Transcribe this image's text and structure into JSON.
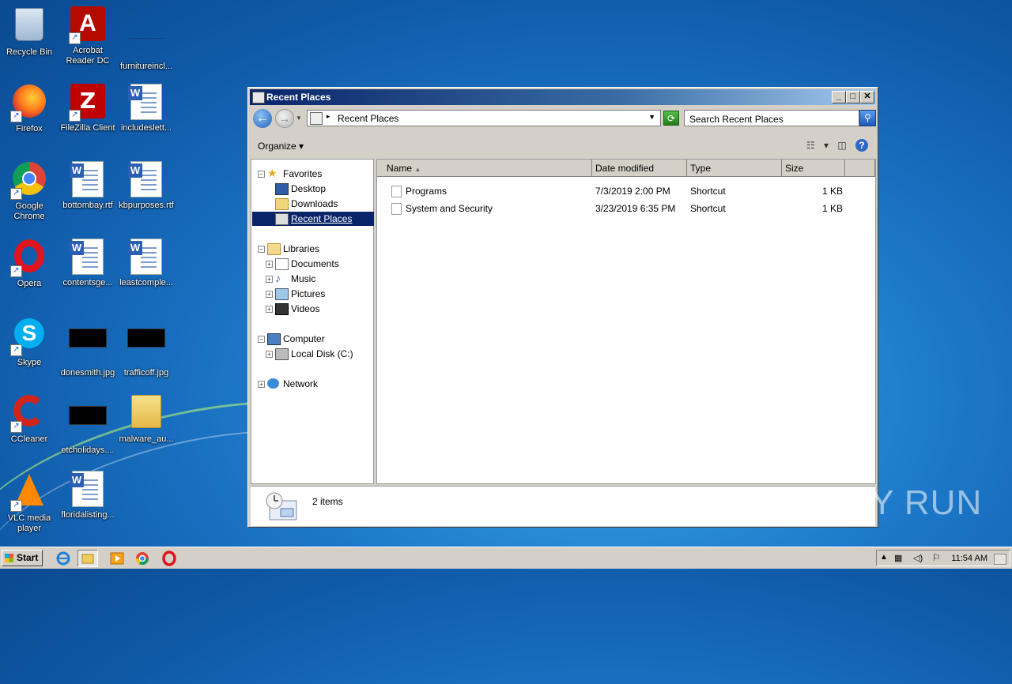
{
  "desktop": {
    "icons": [
      {
        "label": "Recycle Bin"
      },
      {
        "label": "Acrobat Reader DC"
      },
      {
        "label": "furnitureincl..."
      },
      {
        "label": "Firefox"
      },
      {
        "label": "FileZilla Client"
      },
      {
        "label": "includeslett..."
      },
      {
        "label": "Google Chrome"
      },
      {
        "label": "bottombay.rtf"
      },
      {
        "label": "kbpurposes.rtf"
      },
      {
        "label": "Opera"
      },
      {
        "label": "contentsge..."
      },
      {
        "label": "leastcomple..."
      },
      {
        "label": "Skype"
      },
      {
        "label": "donesmith.jpg"
      },
      {
        "label": "trafficoff.jpg"
      },
      {
        "label": "CCleaner"
      },
      {
        "label": "etcholidays...."
      },
      {
        "label": "malware_au..."
      },
      {
        "label": "VLC media player"
      },
      {
        "label": "floridalisting..."
      }
    ]
  },
  "window": {
    "title": "Recent Places",
    "address": "Recent Places",
    "search_placeholder": "Search Recent Places",
    "organize_label": "Organize",
    "nav": {
      "favorites": "Favorites",
      "desktop": "Desktop",
      "downloads": "Downloads",
      "recent_places": "Recent Places",
      "libraries": "Libraries",
      "documents": "Documents",
      "music": "Music",
      "pictures": "Pictures",
      "videos": "Videos",
      "computer": "Computer",
      "local_disk": "Local Disk (C:)",
      "network": "Network"
    },
    "columns": {
      "name": "Name",
      "date_modified": "Date modified",
      "type": "Type",
      "size": "Size"
    },
    "files": [
      {
        "name": "Programs",
        "date": "7/3/2019 2:00 PM",
        "type": "Shortcut",
        "size": "1 KB"
      },
      {
        "name": "System and Security",
        "date": "3/23/2019 6:35 PM",
        "type": "Shortcut",
        "size": "1 KB"
      }
    ],
    "status": "2 items"
  },
  "taskbar": {
    "start_label": "Start",
    "clock": "11:54 AM"
  },
  "watermark": "ANY RUN"
}
